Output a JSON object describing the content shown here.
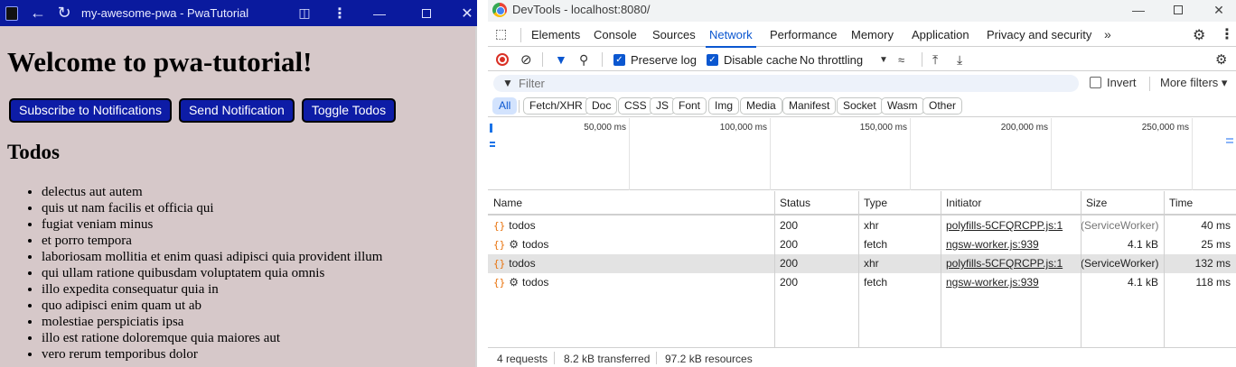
{
  "pwa": {
    "window_title": "my-awesome-pwa - PwaTutorial",
    "heading": "Welcome to pwa-tutorial!",
    "buttons": {
      "subscribe": "Subscribe to Notifications",
      "send": "Send Notification",
      "toggle": "Toggle Todos"
    },
    "todos_heading": "Todos",
    "todos": [
      "delectus aut autem",
      "quis ut nam facilis et officia qui",
      "fugiat veniam minus",
      "et porro tempora",
      "laboriosam mollitia et enim quasi adipisci quia provident illum",
      "qui ullam ratione quibusdam voluptatem quia omnis",
      "illo expedita consequatur quia in",
      "quo adipisci enim quam ut ab",
      "molestiae perspiciatis ipsa",
      "illo est ratione doloremque quia maiores aut",
      "vero rerum temporibus dolor"
    ],
    "colors": {
      "titlebar": "#0a1a9e",
      "background": "#d6c8c9",
      "button": "#0d1ca6"
    }
  },
  "devtools": {
    "window_title": "DevTools - localhost:8080/",
    "tabs": [
      "Elements",
      "Console",
      "Sources",
      "Network",
      "Performance",
      "Memory",
      "Application",
      "Privacy and security"
    ],
    "active_tab": "Network",
    "toolbar": {
      "preserve_log": {
        "label": "Preserve log",
        "checked": true
      },
      "disable_cache": {
        "label": "Disable cache",
        "checked": true
      },
      "throttling": "No throttling"
    },
    "filter": {
      "placeholder": "Filter",
      "invert_label": "Invert",
      "more_filters": "More filters"
    },
    "type_filters": [
      "All",
      "Fetch/XHR",
      "Doc",
      "CSS",
      "JS",
      "Font",
      "Img",
      "Media",
      "Manifest",
      "Socket",
      "Wasm",
      "Other"
    ],
    "active_type_filter": "All",
    "overview_ticks": [
      "50,000 ms",
      "100,000 ms",
      "150,000 ms",
      "200,000 ms",
      "250,000 ms"
    ],
    "columns": [
      "Name",
      "Status",
      "Type",
      "Initiator",
      "Size",
      "Time"
    ],
    "rows": [
      {
        "name": "todos",
        "service_worker": false,
        "status": "200",
        "type": "xhr",
        "initiator": "polyfills-5CFQRCPP.js:1",
        "size": "(ServiceWorker)",
        "time": "40 ms",
        "selected": false
      },
      {
        "name": "todos",
        "service_worker": true,
        "status": "200",
        "type": "fetch",
        "initiator": "ngsw-worker.js:939",
        "size": "4.1 kB",
        "time": "25 ms",
        "selected": false
      },
      {
        "name": "todos",
        "service_worker": false,
        "status": "200",
        "type": "xhr",
        "initiator": "polyfills-5CFQRCPP.js:1",
        "size": "(ServiceWorker)",
        "time": "132 ms",
        "selected": true
      },
      {
        "name": "todos",
        "service_worker": true,
        "status": "200",
        "type": "fetch",
        "initiator": "ngsw-worker.js:939",
        "size": "4.1 kB",
        "time": "118 ms",
        "selected": false
      }
    ],
    "status_bar": {
      "requests": "4 requests",
      "transferred": "8.2 kB transferred",
      "resources": "97.2 kB resources"
    },
    "colors": {
      "accent": "#0b57d0",
      "record": "#d93025",
      "selected_row": "#e3e3e3"
    }
  }
}
